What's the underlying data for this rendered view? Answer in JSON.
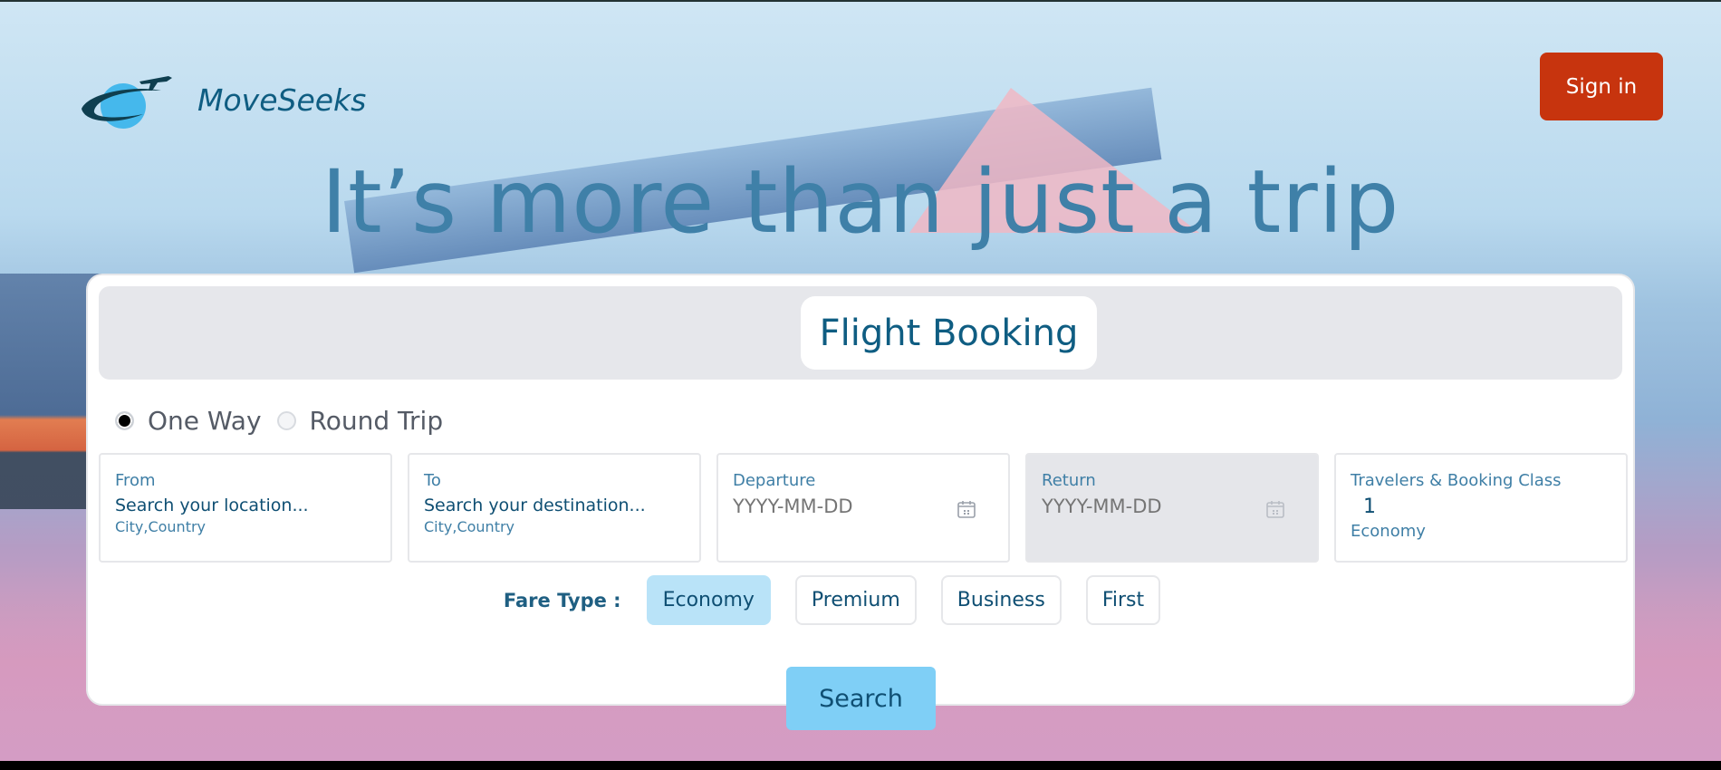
{
  "brand": {
    "name": "MoveSeeks"
  },
  "header": {
    "signin_label": "Sign in"
  },
  "hero": {
    "headline": "It’s more than just a trip"
  },
  "booking": {
    "tab_label": "Flight Booking",
    "trip_types": [
      {
        "label": "One Way",
        "selected": true
      },
      {
        "label": "Round Trip",
        "selected": false
      }
    ],
    "from": {
      "label": "From",
      "value": "Search your location...",
      "hint": "City,Country"
    },
    "to": {
      "label": "To",
      "value": "Search your destination...",
      "hint": "City,Country"
    },
    "departure": {
      "label": "Departure",
      "placeholder": "YYYY-MM-DD"
    },
    "return": {
      "label": "Return",
      "placeholder": "YYYY-MM-DD",
      "disabled": true
    },
    "travelers": {
      "label": "Travelers & Booking Class",
      "count": "1",
      "class": "Economy"
    },
    "fare_type": {
      "label": "Fare Type :",
      "options": [
        "Economy",
        "Premium",
        "Business",
        "First"
      ],
      "selected": "Economy"
    },
    "search_label": "Search"
  },
  "colors": {
    "brand_text": "#0f5d82",
    "signin_bg": "#c7340e",
    "search_bg": "#7fcff6",
    "fare_active_bg": "#b9e3f8"
  }
}
